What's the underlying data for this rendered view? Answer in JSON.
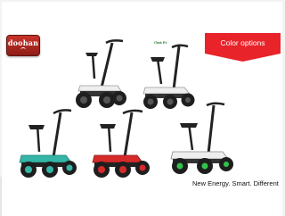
{
  "logo": {
    "text": "doohan"
  },
  "banner": {
    "label": "Color options",
    "color": "#e8232a"
  },
  "tagline": "New Energy. Smart. Different",
  "brand_tag": "iTank EV",
  "colors": {
    "white": "#eeeeee",
    "green": "#34b5a6",
    "red": "#d62a2a",
    "black": "#1b1b1b"
  },
  "variants": [
    {
      "color": "white"
    },
    {
      "color": "white"
    },
    {
      "color": "green"
    },
    {
      "color": "red"
    },
    {
      "color": "white"
    }
  ]
}
